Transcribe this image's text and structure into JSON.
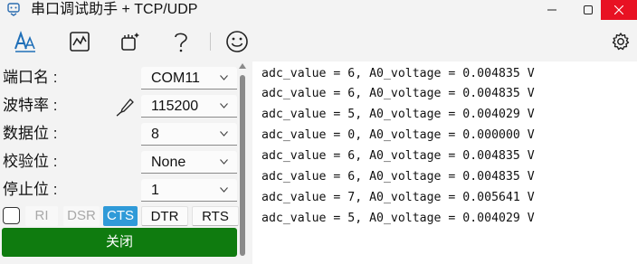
{
  "window": {
    "title": "串口调试助手 + TCP/UDP",
    "close_color": "#e81123"
  },
  "toolbar": {
    "icons": [
      "text-style-icon",
      "waveform-icon",
      "magic-clean-icon",
      "help-icon",
      "smiley-icon",
      "settings-gear-icon"
    ]
  },
  "settings": {
    "port_label": "端口名 :",
    "port_value": "COM11",
    "baud_label": "波特率 :",
    "baud_value": "115200",
    "databits_label": "数据位 :",
    "databits_value": "8",
    "parity_label": "校验位 :",
    "parity_value": "None",
    "stopbits_label": "停止位 :",
    "stopbits_value": "1"
  },
  "signals": {
    "ri": "RI",
    "dsr": "DSR",
    "cts": "CTS",
    "dtr": "DTR",
    "rts": "RTS",
    "active_color": "#2f9ad8"
  },
  "action": {
    "close_label": "关闭",
    "close_color": "#0f7b0f"
  },
  "output": {
    "lines": [
      "adc_value = 6, A0_voltage = 0.004835 V",
      "adc_value = 6, A0_voltage = 0.004835 V",
      "adc_value = 5, A0_voltage = 0.004029 V",
      "adc_value = 0, A0_voltage = 0.000000 V",
      "adc_value = 6, A0_voltage = 0.004835 V",
      "adc_value = 6, A0_voltage = 0.004835 V",
      "adc_value = 7, A0_voltage = 0.005641 V",
      "adc_value = 5, A0_voltage = 0.004029 V"
    ]
  }
}
